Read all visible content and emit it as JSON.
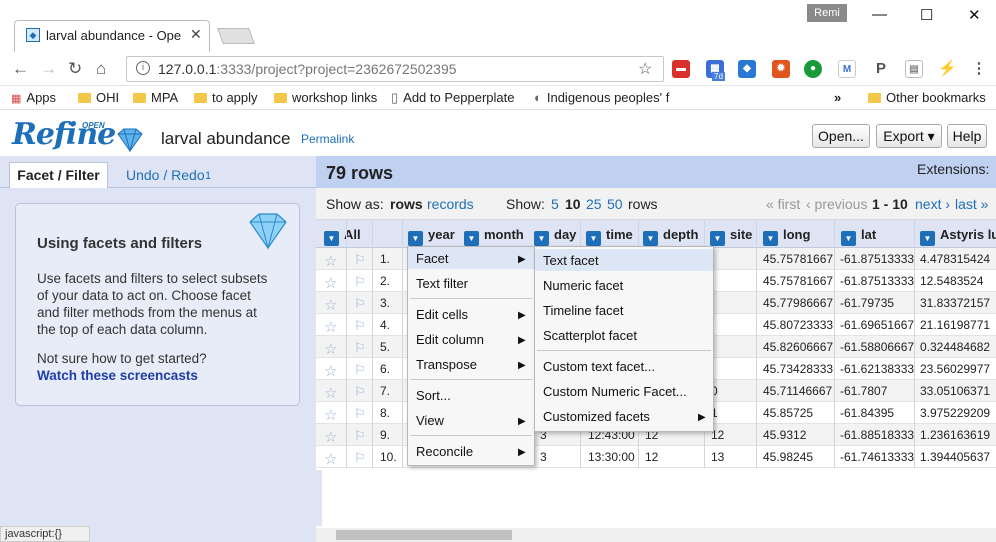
{
  "browser": {
    "tab_title": "larval abundance - Open",
    "user_badge": "Remi",
    "url_host": "127.0.0.1",
    "url_rest": ":3333/project?project=2362672502395",
    "bookmarks": [
      "Apps",
      "OHI",
      "MPA",
      "to apply",
      "workshop links",
      "Add to Pepperplate",
      "Indigenous peoples' f"
    ],
    "other_bookmarks": "Other bookmarks",
    "ext_badge": "7d"
  },
  "app": {
    "logo": "Refine",
    "logo_open": "OPEN",
    "project_name": "larval abundance",
    "permalink": "Permalink",
    "buttons": {
      "open": "Open...",
      "export": "Export ▾",
      "help": "Help"
    }
  },
  "left": {
    "tab_facet": "Facet / Filter",
    "tab_undo": "Undo / Redo",
    "undo_count": "1",
    "help_title": "Using facets and filters",
    "help_body": "Use facets and filters to select subsets of your data to act on. Choose facet and filter methods from the menus at the top of each data column.",
    "help_question": "Not sure how to get started?",
    "help_link": "Watch these screencasts"
  },
  "status": "javascript:{}",
  "grid": {
    "row_count": "79 rows",
    "extensions": "Extensions:",
    "show_as": "Show as:",
    "rows_mode": "rows",
    "records_mode": "records",
    "show": "Show:",
    "sizes": [
      "5",
      "10",
      "25",
      "50"
    ],
    "rows_word": "rows",
    "pager": {
      "first": "« first",
      "previous": "‹ previous",
      "range": "1 - 10",
      "next": "next ›",
      "last": "last »"
    },
    "columns": [
      "All",
      "year",
      "month",
      "day",
      "time",
      "depth",
      "site",
      "long",
      "lat",
      "Astyris lu"
    ],
    "rows": [
      {
        "n": "1.",
        "long": "45.75781667",
        "lat": "-61.87513333",
        "ast": "4.478315424"
      },
      {
        "n": "2.",
        "long": "45.75781667",
        "lat": "-61.87513333",
        "ast": "12.5483524"
      },
      {
        "n": "3.",
        "long": "45.77986667",
        "lat": "-61.79735",
        "ast": "31.83372157"
      },
      {
        "n": "4.",
        "long": "45.80723333",
        "lat": "-61.69651667",
        "ast": "21.16198771"
      },
      {
        "n": "5.",
        "long": "45.82606667",
        "lat": "-61.58806667",
        "ast": "0.324484682"
      },
      {
        "n": "6.",
        "long": "45.73428333",
        "lat": "-61.62138333",
        "ast": "23.56029977"
      },
      {
        "n": "7.",
        "site": "0",
        "long": "45.71146667",
        "lat": "-61.7807",
        "ast": "33.05106371"
      },
      {
        "n": "8.",
        "site": "1",
        "long": "45.85725",
        "lat": "-61.84395",
        "ast": "3.975229209"
      },
      {
        "n": "9.",
        "day": "3",
        "time": "12:43:00",
        "depth": "12",
        "site": "12",
        "long": "45.9312",
        "lat": "-61.88518333",
        "ast": "1.236163619"
      },
      {
        "n": "10.",
        "day": "3",
        "time": "13:30:00",
        "depth": "12",
        "site": "13",
        "long": "45.98245",
        "lat": "-61.74613333",
        "ast": "1.394405637"
      }
    ]
  },
  "menu": {
    "main": [
      "Facet",
      "Text filter",
      "Edit cells",
      "Edit column",
      "Transpose",
      "Sort...",
      "View",
      "Reconcile"
    ],
    "facet_sub": [
      "Text facet",
      "Numeric facet",
      "Timeline facet",
      "Scatterplot facet",
      "Custom text facet...",
      "Custom Numeric Facet...",
      "Customized facets"
    ]
  }
}
